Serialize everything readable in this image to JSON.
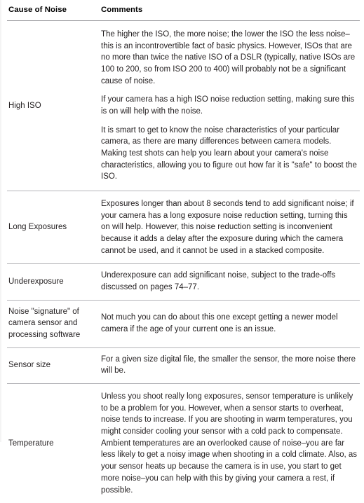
{
  "table": {
    "columns": [
      {
        "key": "cause",
        "label": "Cause of Noise"
      },
      {
        "key": "comments",
        "label": "Comments"
      }
    ],
    "rows": [
      {
        "cause": "High ISO",
        "paragraphs": [
          "The higher the ISO, the more noise; the lower the ISO the less noise–this is an incontrovertible fact of basic physics. However, ISOs that are no more than twice the native ISO of a DSLR (typically, native ISOs are 100 to 200, so from ISO 200 to 400) will probably not be a significant cause of noise.",
          "If your camera has a high ISO noise reduction setting, making sure this is on will help with the noise.",
          "It is smart to get to know the noise characteristics of your particular camera, as there are many differences between camera models. Making test shots can help you learn about your camera's noise characteristics, allowing you to figure out how far it is \"safe\" to boost the ISO."
        ]
      },
      {
        "cause": "Long Exposures",
        "paragraphs": [
          "Exposures longer than about 8 seconds tend to add significant noise; if your camera has a long exposure noise reduction setting, turning this on will help. However, this noise reduction setting is inconvenient because it adds a delay after the exposure during which the camera cannot be used, and it cannot be used in a stacked composite."
        ]
      },
      {
        "cause": "Underexposure",
        "paragraphs": [
          "Underexposure can add significant noise, subject to the trade-offs discussed on pages 74–77."
        ]
      },
      {
        "cause": "Noise \"signature\" of camera sensor and processing software",
        "paragraphs": [
          "Not much you can do about this one except getting a newer model camera if the age of your current one is an issue."
        ]
      },
      {
        "cause": "Sensor size",
        "paragraphs": [
          "For a given size digital file, the smaller the sensor, the more noise there will be."
        ]
      },
      {
        "cause": "Temperature",
        "paragraphs": [
          "Unless you shoot really long exposures, sensor temperature is unlikely to be a problem for you. However, when a sensor starts to overheat, noise tends to increase. If you are shooting in warm temperatures, you might consider cooling your sensor with a cold pack to compensate. Ambient temperatures are an overlooked cause of noise–you are far less likely to get a noisy image when shooting in a cold climate. Also, as your sensor heats up because the camera is in use, you start to get more noise–you can help with this by giving your camera a rest, if possible."
        ]
      }
    ]
  },
  "colors": {
    "text": "#231f20",
    "header_text": "#000000",
    "rule": "#b4b4b8",
    "header_rule": "#9b9b9f",
    "background": "#ffffff"
  }
}
